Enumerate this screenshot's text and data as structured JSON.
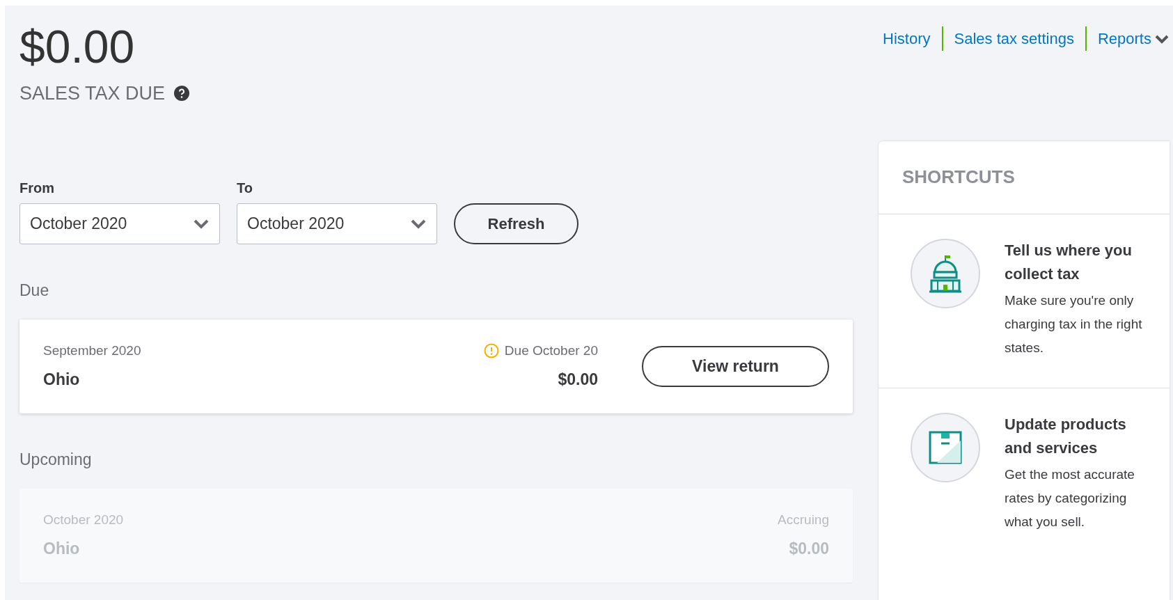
{
  "summary": {
    "amount": "$0.00",
    "label": "SALES TAX DUE"
  },
  "links": [
    {
      "label": "History",
      "kind": "link"
    },
    {
      "label": "Sales tax settings",
      "kind": "link"
    },
    {
      "label": "Reports",
      "kind": "dropdown"
    }
  ],
  "filters": [
    {
      "label": "From",
      "value": "October 2020"
    },
    {
      "label": "To",
      "value": "October 2020"
    }
  ],
  "refresh_button": "Refresh",
  "sections": [
    {
      "title": "Due",
      "returns": [
        {
          "kind": "due",
          "period": "September 2020",
          "state": "Ohio",
          "status": "Due October 20",
          "amount": "$0.00",
          "action": "View return"
        }
      ]
    },
    {
      "title": "Upcoming",
      "returns": [
        {
          "kind": "upcoming",
          "period": "October 2020",
          "state": "Ohio",
          "status": "Accruing",
          "amount": "$0.00"
        }
      ]
    }
  ],
  "shortcuts": {
    "title": "SHORTCUTS",
    "items": [
      {
        "kind": "building",
        "title": "Tell us where you collect tax",
        "description": "Make sure you're only charging tax in the right states."
      },
      {
        "kind": "box",
        "title": "Update products and services",
        "description": "Get the most accurate rates by categorizing what you sell."
      }
    ]
  }
}
